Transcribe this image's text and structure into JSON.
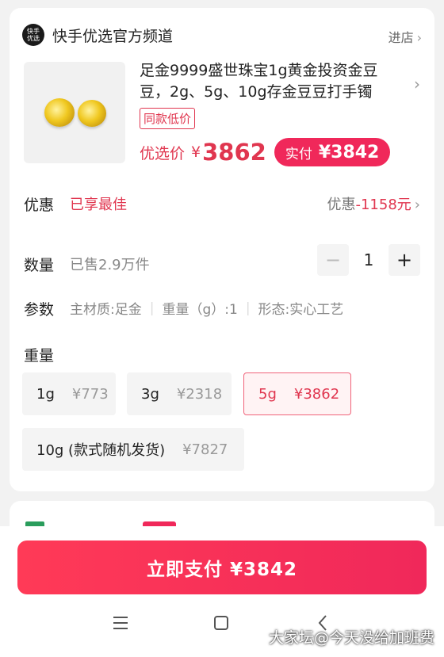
{
  "store": {
    "logo_text": "快手\n优选",
    "name": "快手优选官方频道",
    "enter_label": "进店"
  },
  "product": {
    "title": "足金9999盛世珠宝1g黄金投资金豆豆，2g、5g、10g存金豆豆打手镯",
    "tag": "同款低价",
    "price_label": "优选价",
    "currency": "¥",
    "price": "3862",
    "paid_label": "实付",
    "paid_price": "¥3842"
  },
  "discount": {
    "label": "优惠",
    "value": "已享最佳",
    "right_label": "优惠",
    "right_amount": "-1158元"
  },
  "quantity": {
    "label": "数量",
    "sold": "已售2.9万件",
    "value": "1",
    "minus": "−",
    "plus": "+"
  },
  "params": {
    "label": "参数",
    "items": [
      "主材质:足金",
      "重量（g）:1",
      "形态:实心工艺"
    ]
  },
  "weight": {
    "label": "重量",
    "options": [
      {
        "weight": "1g",
        "price": "¥773",
        "selected": false
      },
      {
        "weight": "3g",
        "price": "¥2318",
        "selected": false
      },
      {
        "weight": "5g",
        "price": "¥3862",
        "selected": true
      },
      {
        "weight": "10g (款式随机发货)",
        "price": "¥7827",
        "selected": false
      }
    ]
  },
  "pay_button": "立即支付 ¥3842",
  "nav": {
    "menu_icon": "menu-icon",
    "home_icon": "home-icon",
    "back_icon": "back-icon"
  },
  "watermark": "大家坛@今天没给加班费",
  "colors": {
    "accent": "#e0364f",
    "button": "#f0285a"
  }
}
